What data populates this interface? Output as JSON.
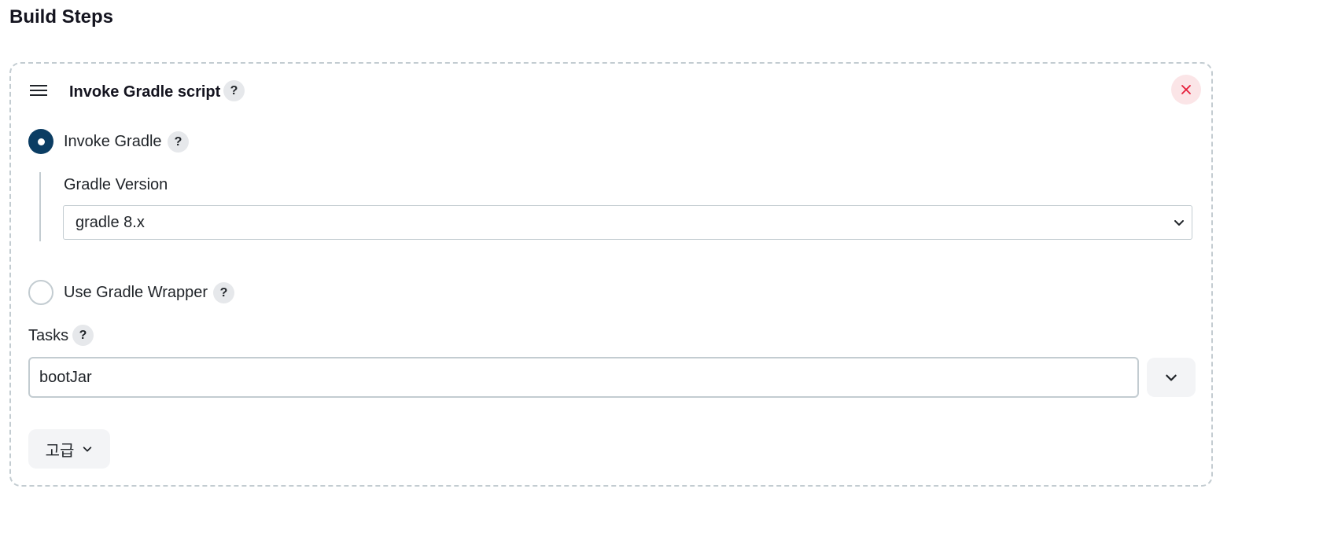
{
  "section": {
    "title": "Build Steps"
  },
  "step": {
    "title": "Invoke Gradle script",
    "help_label": "?",
    "close_icon": "close-icon",
    "drag_icon": "drag-handle-icon"
  },
  "invoke_gradle": {
    "label": "Invoke Gradle",
    "selected": true,
    "help_label": "?",
    "version_label": "Gradle Version",
    "version_value": "gradle 8.x"
  },
  "gradle_wrapper": {
    "label": "Use Gradle Wrapper",
    "selected": false,
    "help_label": "?"
  },
  "tasks": {
    "label": "Tasks",
    "help_label": "?",
    "value": "bootJar",
    "expand_icon": "chevron-down-icon"
  },
  "advanced": {
    "label": "고급",
    "icon": "chevron-down-icon"
  },
  "colors": {
    "accent": "#0b3d63",
    "danger": "#e51d39",
    "danger_bg": "#fbe5e7",
    "border": "#c3ccd1",
    "button_bg": "#f3f4f6"
  }
}
